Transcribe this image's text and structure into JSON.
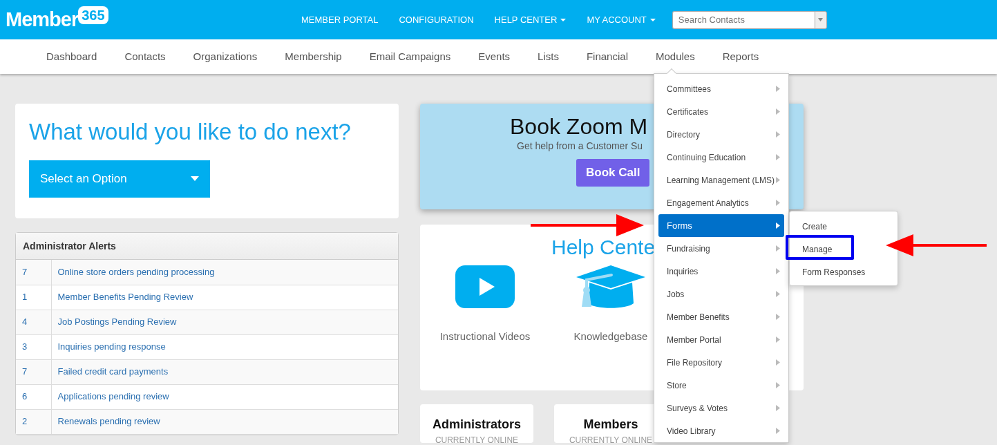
{
  "header": {
    "logo": {
      "word": "Member",
      "badge": "365"
    },
    "links": [
      {
        "label": "MEMBER PORTAL",
        "caret": false
      },
      {
        "label": "CONFIGURATION",
        "caret": false
      },
      {
        "label": "HELP CENTER",
        "caret": true
      },
      {
        "label": "MY ACCOUNT",
        "caret": true
      }
    ],
    "search": {
      "placeholder": "Search Contacts"
    }
  },
  "main_nav": [
    {
      "label": "Dashboard"
    },
    {
      "label": "Contacts"
    },
    {
      "label": "Organizations"
    },
    {
      "label": "Membership"
    },
    {
      "label": "Email Campaigns"
    },
    {
      "label": "Events"
    },
    {
      "label": "Lists"
    },
    {
      "label": "Financial"
    },
    {
      "label": "Modules"
    },
    {
      "label": "Reports"
    }
  ],
  "next_action": {
    "title": "What would you like to do next?",
    "select": "Select an Option"
  },
  "alerts": {
    "title": "Administrator Alerts",
    "rows": [
      {
        "count": "7",
        "text": "Online store orders pending processing"
      },
      {
        "count": "1",
        "text": "Member Benefits Pending Review"
      },
      {
        "count": "4",
        "text": "Job Postings Pending Review"
      },
      {
        "count": "3",
        "text": "Inquiries pending response"
      },
      {
        "count": "7",
        "text": "Failed credit card payments"
      },
      {
        "count": "6",
        "text": "Applications pending review"
      },
      {
        "count": "2",
        "text": "Renewals pending review"
      }
    ]
  },
  "zoom_banner": {
    "title": "Book Zoom M",
    "subtitle": "Get help from a Customer Su",
    "button": "Book Call"
  },
  "help_center": {
    "title": "Help Cente",
    "items": [
      {
        "kind": "video",
        "label": "Instructional Videos"
      },
      {
        "kind": "cap",
        "label": "Knowledgebase"
      }
    ]
  },
  "online_stats": [
    {
      "title": "Administrators",
      "subtitle": "CURRENTLY ONLINE"
    },
    {
      "title": "Members",
      "subtitle": "CURRENTLY ONLINE"
    }
  ],
  "modules_menu": {
    "items": [
      {
        "label": "Committees",
        "selected": false
      },
      {
        "label": "Certificates",
        "selected": false
      },
      {
        "label": "Directory",
        "selected": false
      },
      {
        "label": "Continuing Education",
        "selected": false
      },
      {
        "label": "Learning Management (LMS)",
        "selected": false
      },
      {
        "label": "Engagement Analytics",
        "selected": false
      },
      {
        "label": "Forms",
        "selected": true
      },
      {
        "label": "Fundraising",
        "selected": false
      },
      {
        "label": "Inquiries",
        "selected": false
      },
      {
        "label": "Jobs",
        "selected": false
      },
      {
        "label": "Member Benefits",
        "selected": false
      },
      {
        "label": "Member Portal",
        "selected": false
      },
      {
        "label": "File Repository",
        "selected": false
      },
      {
        "label": "Store",
        "selected": false
      },
      {
        "label": "Surveys & Votes",
        "selected": false
      },
      {
        "label": "Video Library",
        "selected": false
      }
    ]
  },
  "forms_submenu": {
    "items": [
      {
        "label": "Create",
        "boxed": false
      },
      {
        "label": "Manage",
        "boxed": true
      },
      {
        "label": "Form Responses",
        "boxed": false
      }
    ]
  }
}
